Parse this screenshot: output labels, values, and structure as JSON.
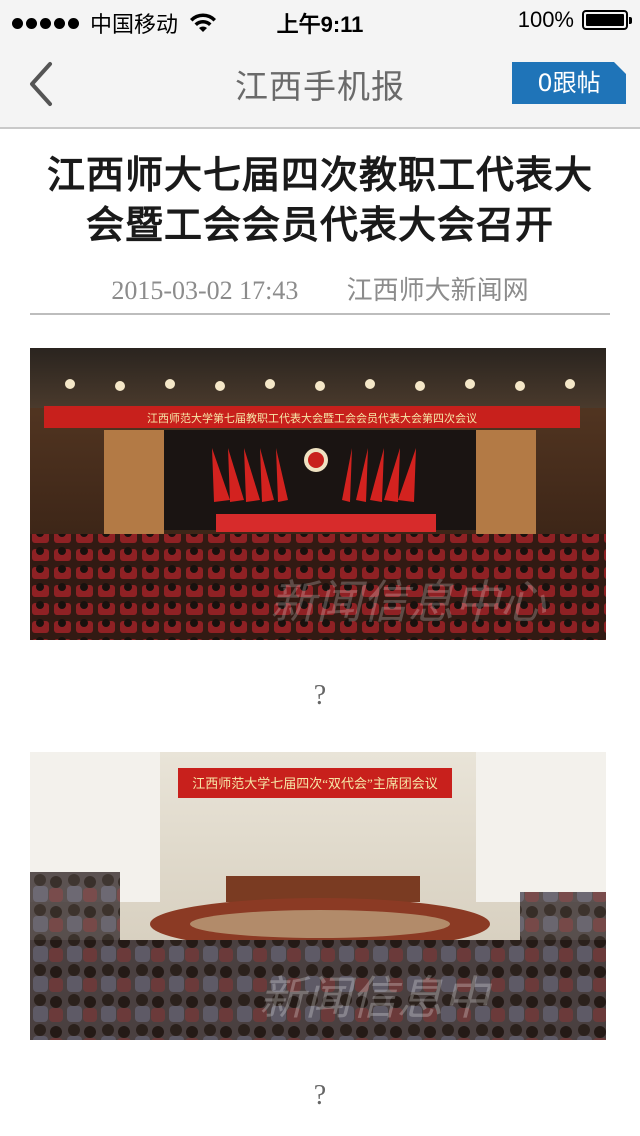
{
  "status_bar": {
    "carrier": "中国移动",
    "time": "上午9:11",
    "battery": "100%"
  },
  "nav": {
    "title": "江西手机报",
    "comments_label": "0跟帖"
  },
  "article": {
    "title": "江西师大七届四次教职工代表大会暨工会会员代表大会召开",
    "date": "2015-03-02 17:43",
    "source": "江西师大新闻网"
  },
  "photos": [
    {
      "banner": "江西师范大学第七届教职工代表大会暨工会会员代表大会第四次会议",
      "watermark": "新闻信息中心",
      "caption": "?"
    },
    {
      "banner": "江西师范大学七届四次“双代会”主席团会议",
      "watermark": "新闻信息中",
      "caption": "?"
    }
  ],
  "colors": {
    "accent": "#1f74b8",
    "stage_red": "#c8201c"
  }
}
